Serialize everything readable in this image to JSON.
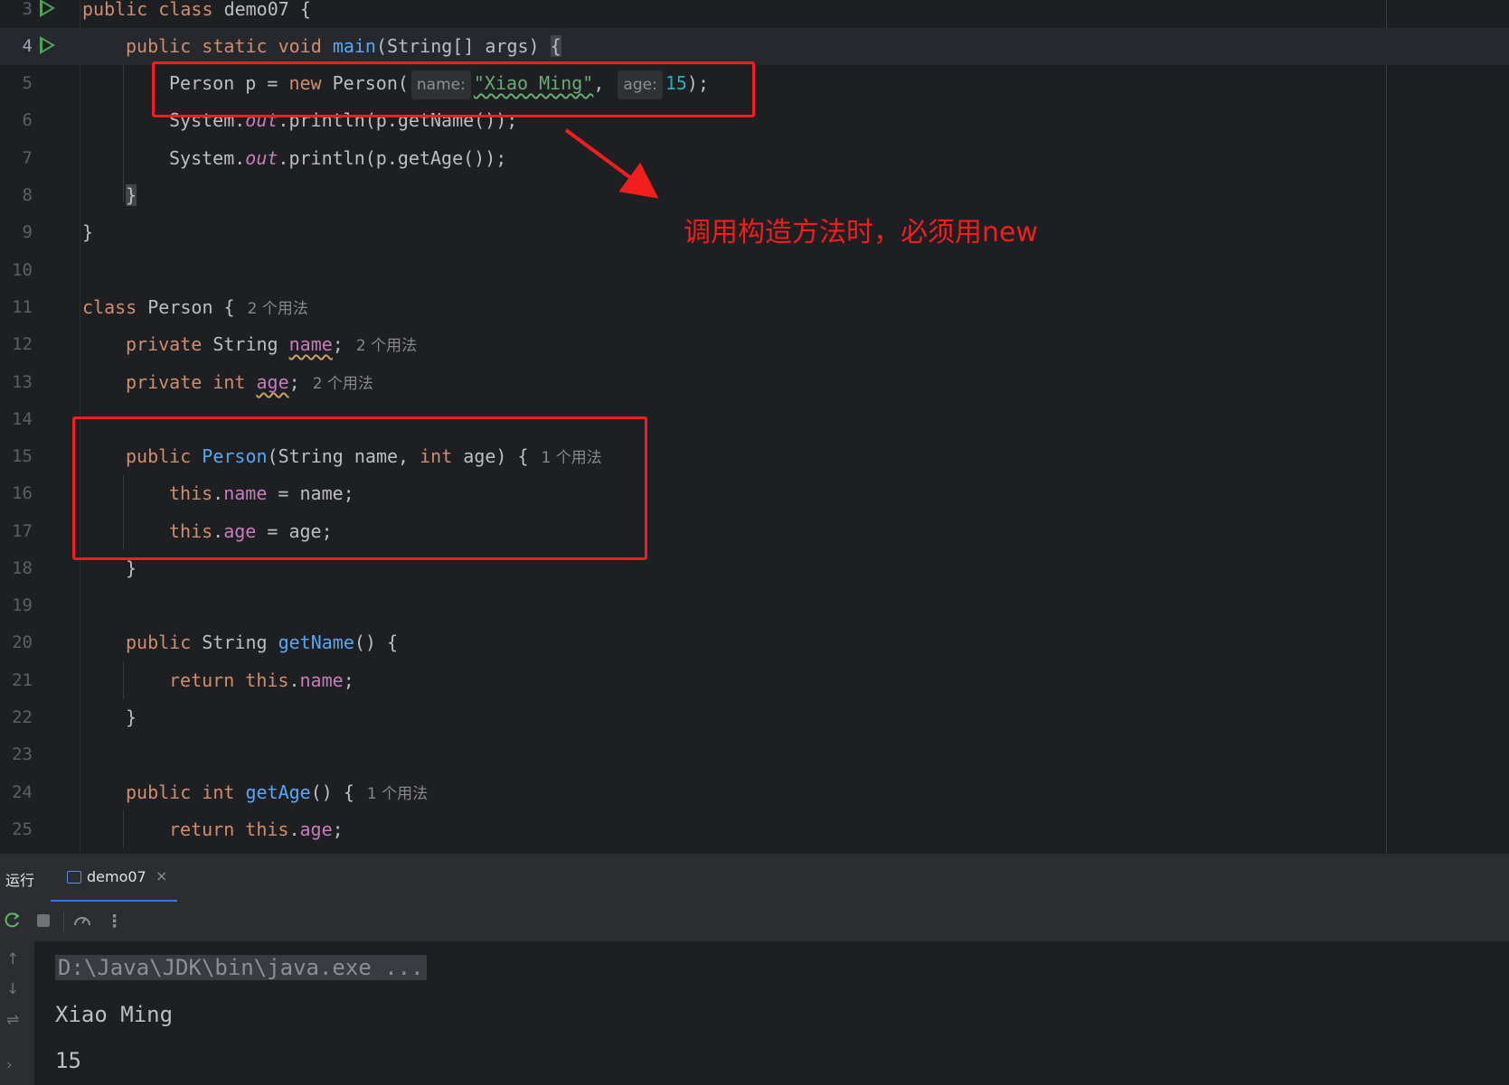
{
  "editor": {
    "lines": [
      {
        "n": "3"
      },
      {
        "n": "4"
      },
      {
        "n": "5"
      },
      {
        "n": "6"
      },
      {
        "n": "7"
      },
      {
        "n": "8"
      },
      {
        "n": "9"
      },
      {
        "n": "10"
      },
      {
        "n": "11"
      },
      {
        "n": "12"
      },
      {
        "n": "13"
      },
      {
        "n": "14"
      },
      {
        "n": "15"
      },
      {
        "n": "16"
      },
      {
        "n": "17"
      },
      {
        "n": "18"
      },
      {
        "n": "19"
      },
      {
        "n": "20"
      },
      {
        "n": "21"
      },
      {
        "n": "22"
      },
      {
        "n": "23"
      },
      {
        "n": "24"
      },
      {
        "n": "25"
      }
    ],
    "code": {
      "l3": {
        "kw1": "public",
        "kw2": "class",
        "name": "demo07",
        "brace": "{"
      },
      "l4": {
        "kw1": "public",
        "kw2": "static",
        "kw3": "void",
        "fn": "main",
        "params": "(String[] args) ",
        "brace": "{"
      },
      "l5": {
        "pre": "Person p = ",
        "kw": "new",
        "call": " Person(",
        "hint1": "name:",
        "str": "\"Xiao Ming\"",
        "comma": ",",
        "hint2": "age:",
        "num": "15",
        "post": ");"
      },
      "l6": {
        "pre": "System.",
        "st": "out",
        "post": ".println(p.getName());"
      },
      "l7": {
        "pre": "System.",
        "st": "out",
        "post": ".println(p.getAge());"
      },
      "l8": {
        "brace": "}"
      },
      "l9": {
        "brace": "}"
      },
      "l11": {
        "kw": "class",
        "name": " Person {",
        "usage": "2 个用法"
      },
      "l12": {
        "kw": "private",
        "type": " String ",
        "fld": "name",
        "semi": ";",
        "usage": "2 个用法"
      },
      "l13": {
        "kw": "private",
        "type": " ",
        "kw2": "int",
        "sp": " ",
        "fld": "age",
        "semi": ";",
        "usage": "2 个用法"
      },
      "l15": {
        "kw": "public",
        "sp": " ",
        "fn": "Person",
        "params1": "(String name, ",
        "kw2": "int",
        "params2": " age) {",
        "usage": "1 个用法"
      },
      "l16": {
        "kw": "this",
        "dot": ".",
        "fld": "name",
        "post": " = name;"
      },
      "l17": {
        "kw": "this",
        "dot": ".",
        "fld": "age",
        "post": " = age;"
      },
      "l18": {
        "brace": "}"
      },
      "l20": {
        "kw": "public",
        "type": " String ",
        "fn": "getName",
        "post": "() {"
      },
      "l21": {
        "kw": "return",
        "sp": " ",
        "kw2": "this",
        "dot": ".",
        "fld": "name",
        "semi": ";"
      },
      "l22": {
        "brace": "}"
      },
      "l24": {
        "kw": "public",
        "sp": " ",
        "kw2": "int",
        "sp2": " ",
        "fn": "getAge",
        "post": "() {",
        "usage": "1 个用法"
      },
      "l25": {
        "kw": "return",
        "sp": " ",
        "kw2": "this",
        "dot": ".",
        "fld": "age",
        "semi": ";"
      }
    },
    "annotation": "调用构造方法时，必须用new",
    "annotation_color": "#f01e1e"
  },
  "run_panel": {
    "title": "运行",
    "tab_label": "demo07",
    "tab_close": "×",
    "toolbar": {
      "more": "⋮"
    },
    "side_icons": {
      "up": "↑",
      "down": "↓",
      "wrap": "⇌",
      "expand": "›"
    },
    "console": {
      "command": "D:\\Java\\JDK\\bin\\java.exe ...",
      "out1": "Xiao Ming",
      "out2": "15"
    }
  }
}
